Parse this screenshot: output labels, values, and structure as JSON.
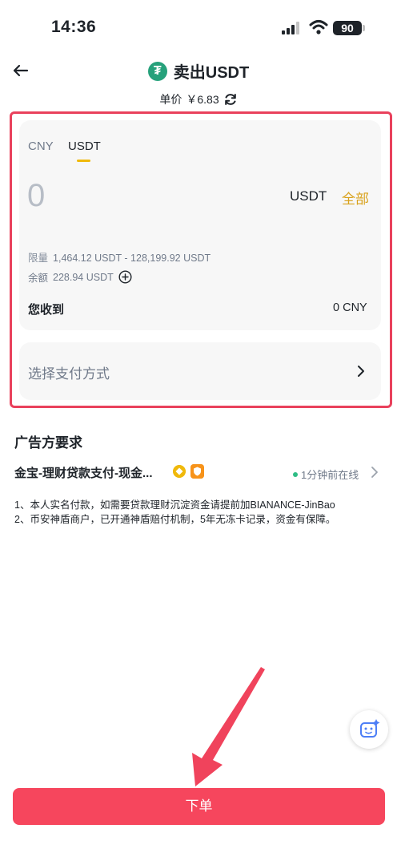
{
  "status_bar": {
    "time": "14:36",
    "battery": "90"
  },
  "header": {
    "title": "卖出USDT",
    "coin_glyph": "₮",
    "price_label": "单价",
    "price_value": "￥6.83"
  },
  "amount_card": {
    "tabs": [
      "CNY",
      "USDT"
    ],
    "active_tab": "USDT",
    "amount_value": "0",
    "unit": "USDT",
    "all_label": "全部",
    "limit_label": "限量",
    "limit_value": "1,464.12 USDT - 128,199.92 USDT",
    "balance_label": "余额",
    "balance_value": "228.94 USDT",
    "receive_label": "您收到",
    "receive_value": "0 CNY"
  },
  "payment": {
    "placeholder": "选择支付方式"
  },
  "advertiser": {
    "section_title": "广告方要求",
    "merchant_name": "金宝-理财贷款支付-现金...",
    "online_status": "1分钟前在线",
    "terms": [
      "1、本人实名付款，如需要贷款理财沉淀资金请提前加BIANANCE-JinBao",
      "2、币安神盾商户，已开通神盾赔付机制，5年无冻卡记录，资金有保障。"
    ]
  },
  "footer": {
    "order_button": "下单"
  },
  "colors": {
    "accent_red": "#f6465d",
    "highlight_frame": "#e9415c",
    "gold": "#d9a21b",
    "tether_green": "#26a17b",
    "online_green": "#2ebd85"
  }
}
